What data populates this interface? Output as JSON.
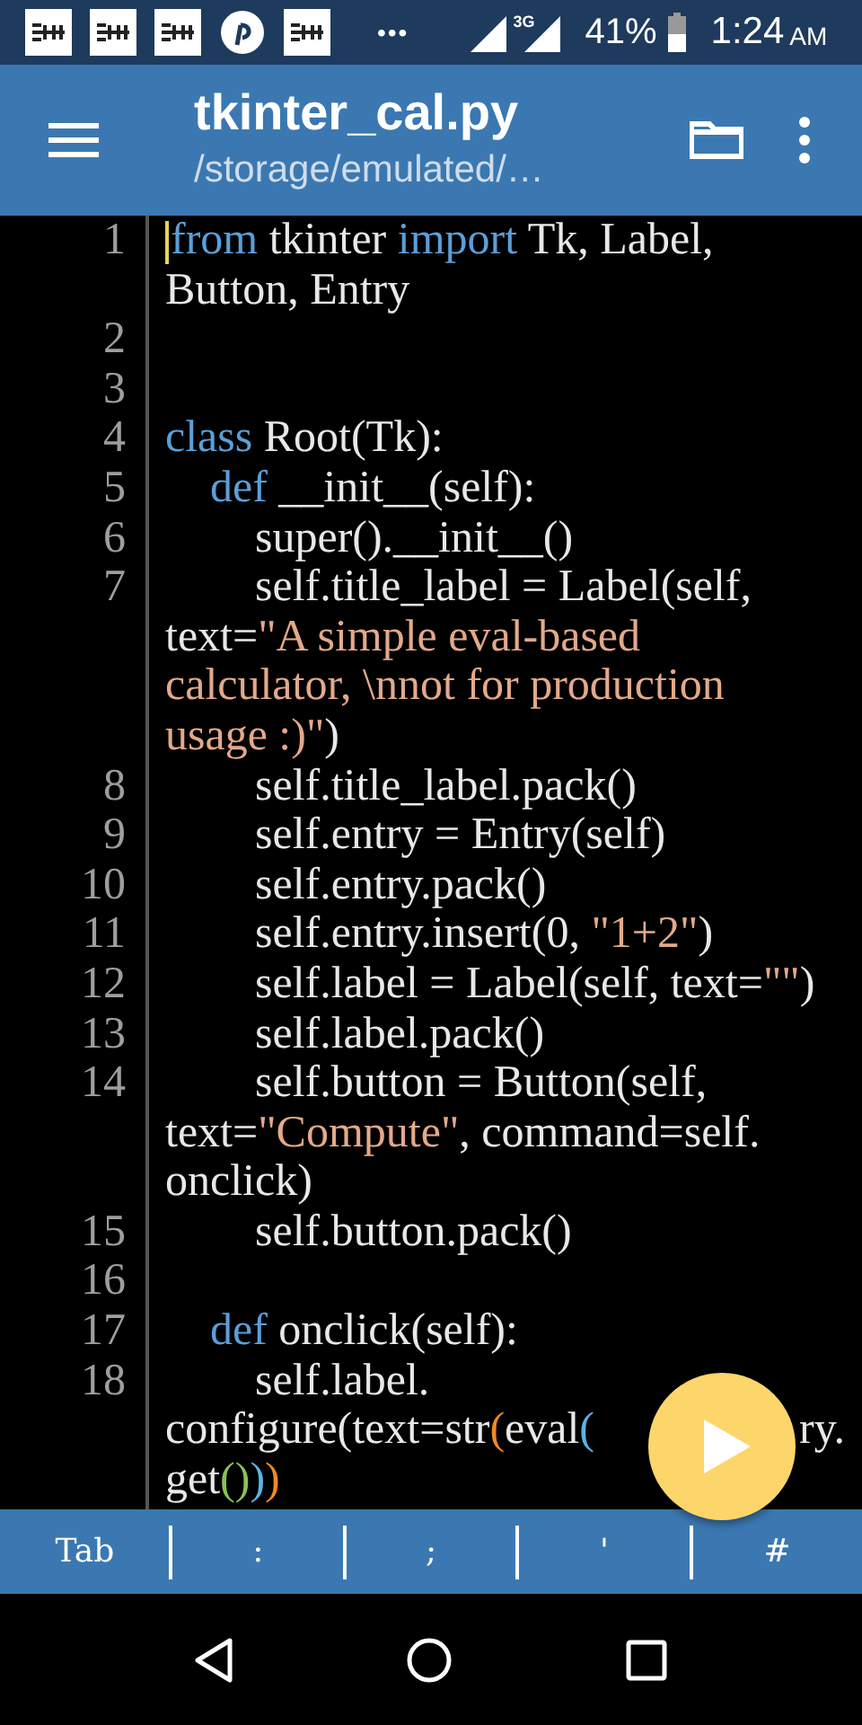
{
  "status_bar": {
    "notifications": [
      {
        "kind": "news"
      },
      {
        "kind": "news"
      },
      {
        "kind": "news"
      },
      {
        "kind": "pin"
      },
      {
        "kind": "news"
      }
    ],
    "more": "•••",
    "network": "3G",
    "battery": "41%",
    "time": "1:24",
    "meridiem": "AM"
  },
  "app_bar": {
    "title": "tkinter_cal.py",
    "subtitle": "/storage/emulated/…"
  },
  "editor": {
    "lines": [
      {
        "number": "1",
        "cursor": true,
        "rows": [
          {
            "tokens": [
              {
                "kind": "keyword",
                "text": "from"
              },
              {
                "kind": "plain",
                "text": " tkinter "
              },
              {
                "kind": "keyword",
                "text": "import"
              },
              {
                "kind": "plain",
                "text": " Tk, Label,"
              }
            ]
          },
          {
            "tokens": [
              {
                "kind": "plain",
                "text": "Button, Entry"
              }
            ]
          }
        ]
      },
      {
        "number": "2",
        "cursor": false
      },
      {
        "number": "3",
        "cursor": false
      },
      {
        "number": "4",
        "cursor": false,
        "rows": [
          {
            "tokens": [
              {
                "kind": "keyword",
                "text": "class"
              },
              {
                "kind": "plain",
                "text": " Root(Tk):"
              }
            ]
          }
        ]
      },
      {
        "number": "5",
        "cursor": false,
        "rows": [
          {
            "tokens": [
              {
                "kind": "keyword",
                "text": "    def"
              },
              {
                "kind": "plain",
                "text": " __init__(self):"
              }
            ]
          }
        ]
      },
      {
        "number": "6",
        "cursor": false,
        "rows": [
          {
            "tokens": [
              {
                "kind": "plain",
                "text": "        super().__init__()"
              }
            ]
          }
        ]
      },
      {
        "number": "7",
        "cursor": false,
        "rows": [
          {
            "tokens": [
              {
                "kind": "plain",
                "text": "        self.title_label = Label(self,"
              }
            ]
          },
          {
            "tokens": [
              {
                "kind": "plain",
                "text": "text="
              },
              {
                "kind": "string",
                "text": "\"A simple eval-based"
              }
            ]
          },
          {
            "tokens": [
              {
                "kind": "string",
                "text": "calculator, \\nnot for production"
              }
            ]
          },
          {
            "tokens": [
              {
                "kind": "string",
                "text": "usage :)\""
              },
              {
                "kind": "plain",
                "text": ")"
              }
            ]
          }
        ]
      },
      {
        "number": "8",
        "cursor": false,
        "rows": [
          {
            "tokens": [
              {
                "kind": "plain",
                "text": "        self.title_label.pack()"
              }
            ]
          }
        ]
      },
      {
        "number": "9",
        "cursor": false,
        "rows": [
          {
            "tokens": [
              {
                "kind": "plain",
                "text": "        self.entry = Entry(self)"
              }
            ]
          }
        ]
      },
      {
        "number": "10",
        "cursor": false,
        "rows": [
          {
            "tokens": [
              {
                "kind": "plain",
                "text": "        self.entry.pack()"
              }
            ]
          }
        ]
      },
      {
        "number": "11",
        "cursor": false,
        "rows": [
          {
            "tokens": [
              {
                "kind": "plain",
                "text": "        self.entry.insert(0, "
              },
              {
                "kind": "string",
                "text": "\"1+2\""
              },
              {
                "kind": "plain",
                "text": ")"
              }
            ]
          }
        ]
      },
      {
        "number": "12",
        "cursor": false,
        "rows": [
          {
            "tokens": [
              {
                "kind": "plain",
                "text": "        self.label = Label(self, text="
              },
              {
                "kind": "string",
                "text": "\"\""
              },
              {
                "kind": "plain",
                "text": ")"
              }
            ]
          }
        ]
      },
      {
        "number": "13",
        "cursor": false,
        "rows": [
          {
            "tokens": [
              {
                "kind": "plain",
                "text": "        self.label.pack()"
              }
            ]
          }
        ]
      },
      {
        "number": "14",
        "cursor": false,
        "rows": [
          {
            "tokens": [
              {
                "kind": "plain",
                "text": "        self.button = Button(self,"
              }
            ]
          },
          {
            "tokens": [
              {
                "kind": "plain",
                "text": "text="
              },
              {
                "kind": "string",
                "text": "\"Compute\""
              },
              {
                "kind": "plain",
                "text": ", command=self."
              }
            ]
          },
          {
            "tokens": [
              {
                "kind": "plain",
                "text": "onclick)"
              }
            ]
          }
        ]
      },
      {
        "number": "15",
        "cursor": false,
        "rows": [
          {
            "tokens": [
              {
                "kind": "plain",
                "text": "        self.button.pack()"
              }
            ]
          }
        ]
      },
      {
        "number": "16",
        "cursor": false
      },
      {
        "number": "17",
        "cursor": false,
        "rows": [
          {
            "tokens": [
              {
                "kind": "keyword",
                "text": "    def"
              },
              {
                "kind": "plain",
                "text": " onclick(self):"
              }
            ]
          }
        ]
      },
      {
        "number": "18",
        "cursor": false,
        "rows": [
          {
            "tokens": [
              {
                "kind": "plain",
                "text": "        self.label."
              }
            ]
          },
          {
            "tokens": [
              {
                "kind": "plain",
                "text": "configure(text=str"
              },
              {
                "kind": "bracket",
                "text": "(",
                "color": "#f08a24"
              },
              {
                "kind": "plain",
                "text": "eval"
              },
              {
                "kind": "bracket",
                "text": "(",
                "color": "#5ab4e6"
              },
              {
                "kind": "covered"
              },
              {
                "kind": "plain",
                "text": "ry."
              }
            ]
          },
          {
            "tokens": [
              {
                "kind": "plain",
                "text": "get"
              },
              {
                "kind": "bracket",
                "text": "()",
                "color": "#8cc152"
              },
              {
                "kind": "bracket",
                "text": ")",
                "color": "#5ab4e6"
              },
              {
                "kind": "bracket",
                "text": ")",
                "color": "#f08a24"
              }
            ]
          }
        ]
      }
    ]
  },
  "run_button": {
    "kind": "play"
  },
  "key_bar": {
    "keys": [
      "Tab",
      ":",
      ";",
      "'",
      "#"
    ]
  }
}
